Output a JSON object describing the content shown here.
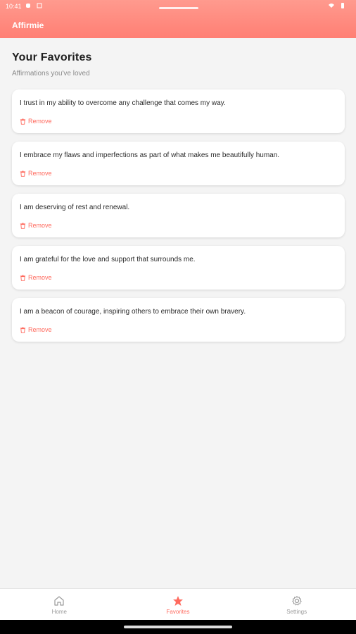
{
  "status_bar": {
    "time": "10:41"
  },
  "app": {
    "title": "Affirmie",
    "accent_color": "#ff6a5e"
  },
  "page": {
    "title": "Your Favorites",
    "subtitle": "Affirmations you've loved"
  },
  "favorites": [
    {
      "text": "I trust in my ability to overcome any challenge that comes my way.",
      "remove_label": "Remove"
    },
    {
      "text": "I embrace my flaws and imperfections as part of what makes me beautifully human.",
      "remove_label": "Remove"
    },
    {
      "text": "I am deserving of rest and renewal.",
      "remove_label": "Remove"
    },
    {
      "text": "I am grateful for the love and support that surrounds me.",
      "remove_label": "Remove"
    },
    {
      "text": "I am a beacon of courage, inspiring others to embrace their own bravery.",
      "remove_label": "Remove"
    }
  ],
  "bottom_nav": {
    "items": [
      {
        "label": "Home",
        "icon": "home-icon"
      },
      {
        "label": "Favorites",
        "icon": "star-icon",
        "active": true
      },
      {
        "label": "Settings",
        "icon": "gear-icon"
      }
    ]
  }
}
